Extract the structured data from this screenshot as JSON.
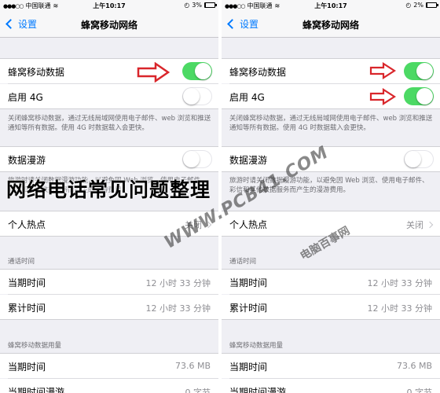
{
  "screens": [
    {
      "status": {
        "carrier": "中国联通",
        "time": "上午10:17",
        "battery": "3%",
        "battery_fraction": 0.03
      },
      "nav": {
        "back": "设置",
        "title": "蜂窝移动网络"
      },
      "cellular_data": {
        "label": "蜂窝移动数据",
        "on": true
      },
      "lte": {
        "label": "启用 4G",
        "on": false
      },
      "footnote1": "关闭蜂窝移动数据，通过无线局域网使用电子邮件、web 浏览和推送通知等所有数据。使用 4G 时数据载入会更快。",
      "roaming": {
        "label": "数据漫游",
        "on": false
      },
      "footnote2": "旅游时请关闭数据漫游功能，以避免因 Web 浏览、使用电子邮件、彩信和其他数据服务而产生的漫游费用。",
      "hotspot": {
        "label": "个人热点",
        "value": "关闭"
      },
      "call_time_header": "通话时间",
      "current_period": {
        "label": "当期时间",
        "value": "12 小时 33 分钟"
      },
      "lifetime": {
        "label": "累计时间",
        "value": "12 小时 33 分钟"
      },
      "usage_header": "蜂窝移动数据用量",
      "usage_current": {
        "label": "当期时间",
        "value": "73.6 MB"
      },
      "usage_roaming": {
        "label": "当期时间漫游",
        "value": "0 字节"
      }
    },
    {
      "status": {
        "carrier": "中国联通",
        "time": "上午10:17",
        "battery": "2%",
        "battery_fraction": 0.02
      },
      "nav": {
        "back": "设置",
        "title": "蜂窝移动网络"
      },
      "cellular_data": {
        "label": "蜂窝移动数据",
        "on": true
      },
      "lte": {
        "label": "启用 4G",
        "on": true
      },
      "footnote1": "关闭蜂窝移动数据，通过无线局域网使用电子邮件、web 浏览和推送通知等所有数据。使用 4G 时数据载入会更快。",
      "roaming": {
        "label": "数据漫游",
        "on": false
      },
      "footnote2": "旅游时请关闭数据漫游功能，以避免因 Web 浏览、使用电子邮件、彩信和其他数据服务而产生的漫游费用。",
      "hotspot": {
        "label": "个人热点",
        "value": "关闭"
      },
      "call_time_header": "通话时间",
      "current_period": {
        "label": "当期时间",
        "value": "12 小时 33 分钟"
      },
      "lifetime": {
        "label": "累计时间",
        "value": "12 小时 33 分钟"
      },
      "usage_header": "蜂窝移动数据用量",
      "usage_current": {
        "label": "当期时间",
        "value": "73.6 MB"
      },
      "usage_roaming": {
        "label": "当期时间漫游",
        "value": "0 字节"
      }
    }
  ],
  "overlay": {
    "title": "网络电话常见问题整理",
    "watermark": "WWW.PCB41.COM",
    "watermark2": "电脑百事网"
  },
  "colors": {
    "accent": "#007aff",
    "toggle_on": "#4cd964",
    "arrow": "#d9262b"
  },
  "icons": [
    "chevron-left-icon",
    "chevron-right-icon",
    "wifi-icon",
    "battery-icon",
    "red-arrow-icon"
  ]
}
